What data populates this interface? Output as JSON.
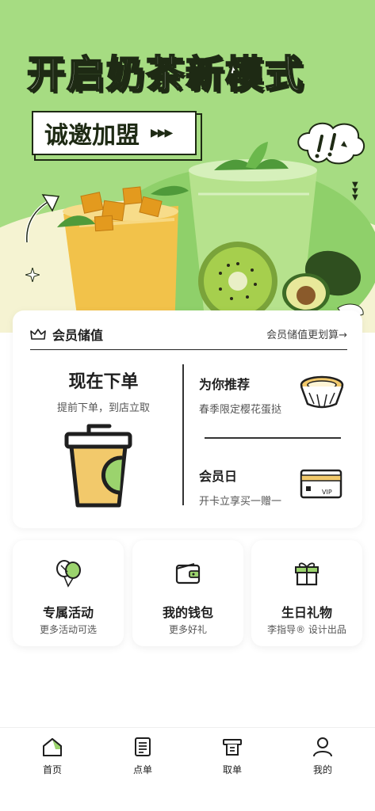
{
  "banner": {
    "headline": "开启奶茶新模式",
    "join_label": "诚邀加盟",
    "join_arrows": "▶▶▶"
  },
  "member": {
    "title": "会员储值",
    "more": "会员储值更划算→",
    "order_title": "现在下单",
    "order_sub": "提前下单，到店立取",
    "rec_title": "为你推荐",
    "rec_sub": "春季限定樱花蛋挞",
    "day_title": "会员日",
    "day_sub": "开卡立享买一赠一",
    "vip_label": "VIP"
  },
  "features": [
    {
      "title": "专属活动",
      "sub": "更多活动可选",
      "icon": "balloon-icon"
    },
    {
      "title": "我的钱包",
      "sub": "更多好礼",
      "icon": "wallet-icon"
    },
    {
      "title": "生日礼物",
      "sub": "李指导® 设计出品",
      "icon": "gift-icon"
    }
  ],
  "nav": [
    {
      "label": "首页",
      "icon": "home-icon"
    },
    {
      "label": "点单",
      "icon": "order-icon"
    },
    {
      "label": "取单",
      "icon": "pickup-icon"
    },
    {
      "label": "我的",
      "icon": "profile-icon"
    }
  ],
  "colors": {
    "brand_green": "#a6dc82",
    "cream": "#f5f3d2",
    "cup_yellow": "#f2c96b",
    "cup_green": "#9bd36d",
    "ink": "#1e2a14"
  }
}
